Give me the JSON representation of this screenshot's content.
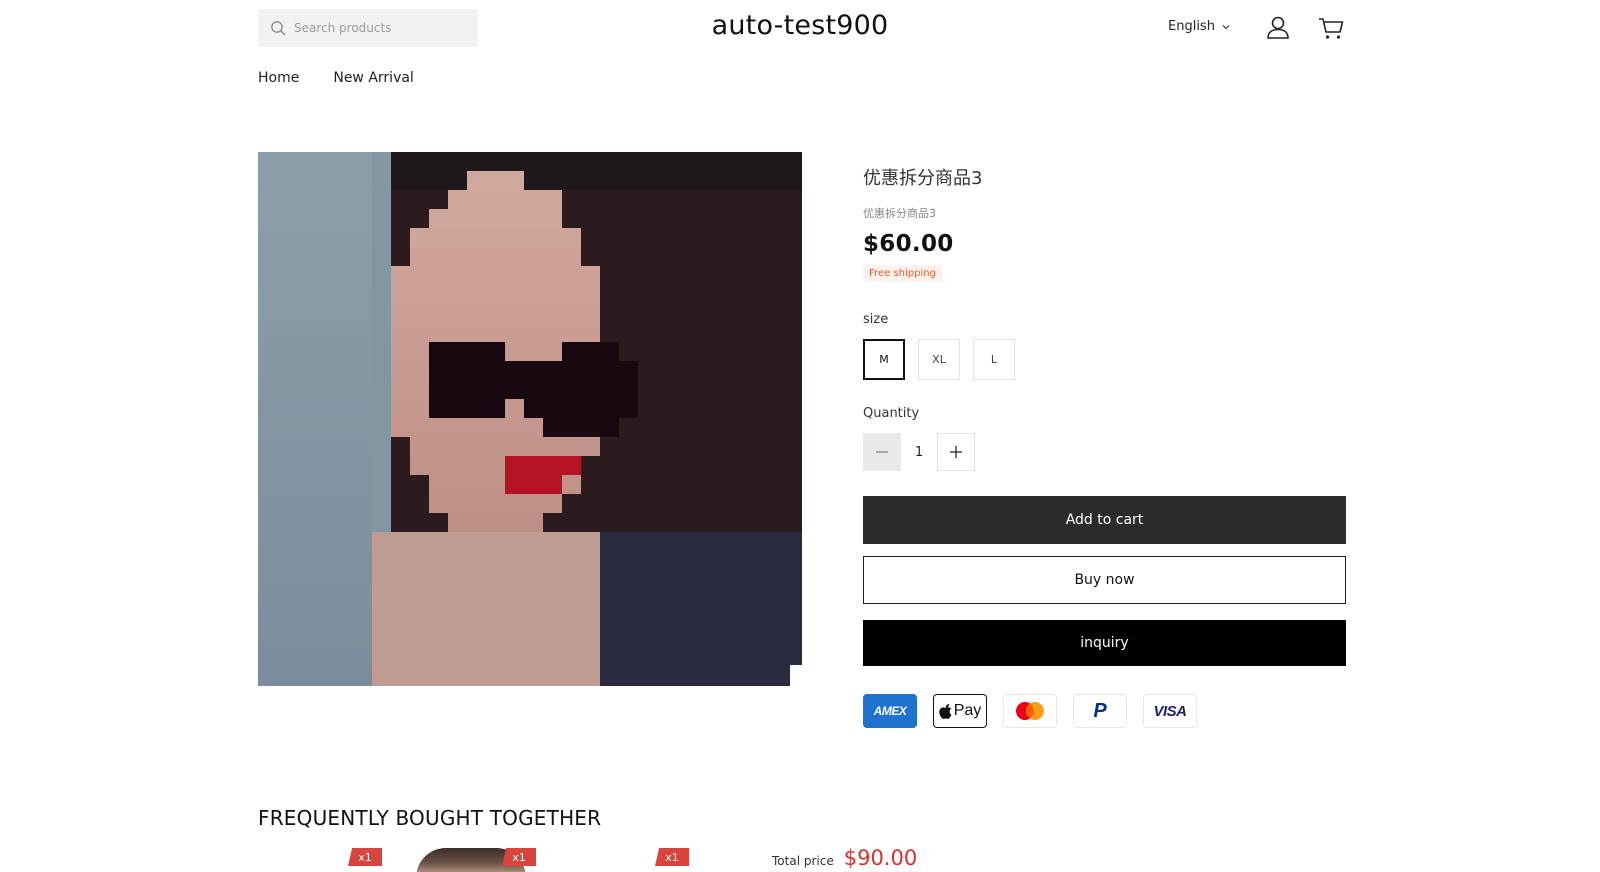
{
  "header": {
    "search_placeholder": "Search products",
    "logo": "auto-test900",
    "language": "English"
  },
  "nav": {
    "items": [
      {
        "label": "Home"
      },
      {
        "label": "New Arrival"
      }
    ]
  },
  "product": {
    "title": "优惠拆分商品3",
    "subtitle": "优惠拆分商品3",
    "price": "$60.00",
    "shipping_badge": "Free shipping",
    "size_label": "size",
    "sizes": [
      "M",
      "XL",
      "L"
    ],
    "selected_size": "M",
    "quantity_label": "Quantity",
    "quantity": "1",
    "add_to_cart": "Add to cart",
    "buy_now": "Buy now",
    "inquiry": "inquiry"
  },
  "payments": [
    {
      "name": "amex-icon",
      "text": "AMEX"
    },
    {
      "name": "apple-pay-icon",
      "text": "Pay"
    },
    {
      "name": "mastercard-icon"
    },
    {
      "name": "paypal-icon",
      "text": "P"
    },
    {
      "name": "visa-icon",
      "text": "VISA"
    }
  ],
  "fbt": {
    "title": "FREQUENTLY BOUGHT TOGETHER",
    "tags": [
      "x1",
      "x1",
      "x1"
    ],
    "total_label": "Total price",
    "total_value": "$90.00"
  },
  "colors": {
    "accent_red": "#d9322b",
    "shipping_orange": "#e85d2a",
    "button_dark": "#2b2b2b"
  }
}
